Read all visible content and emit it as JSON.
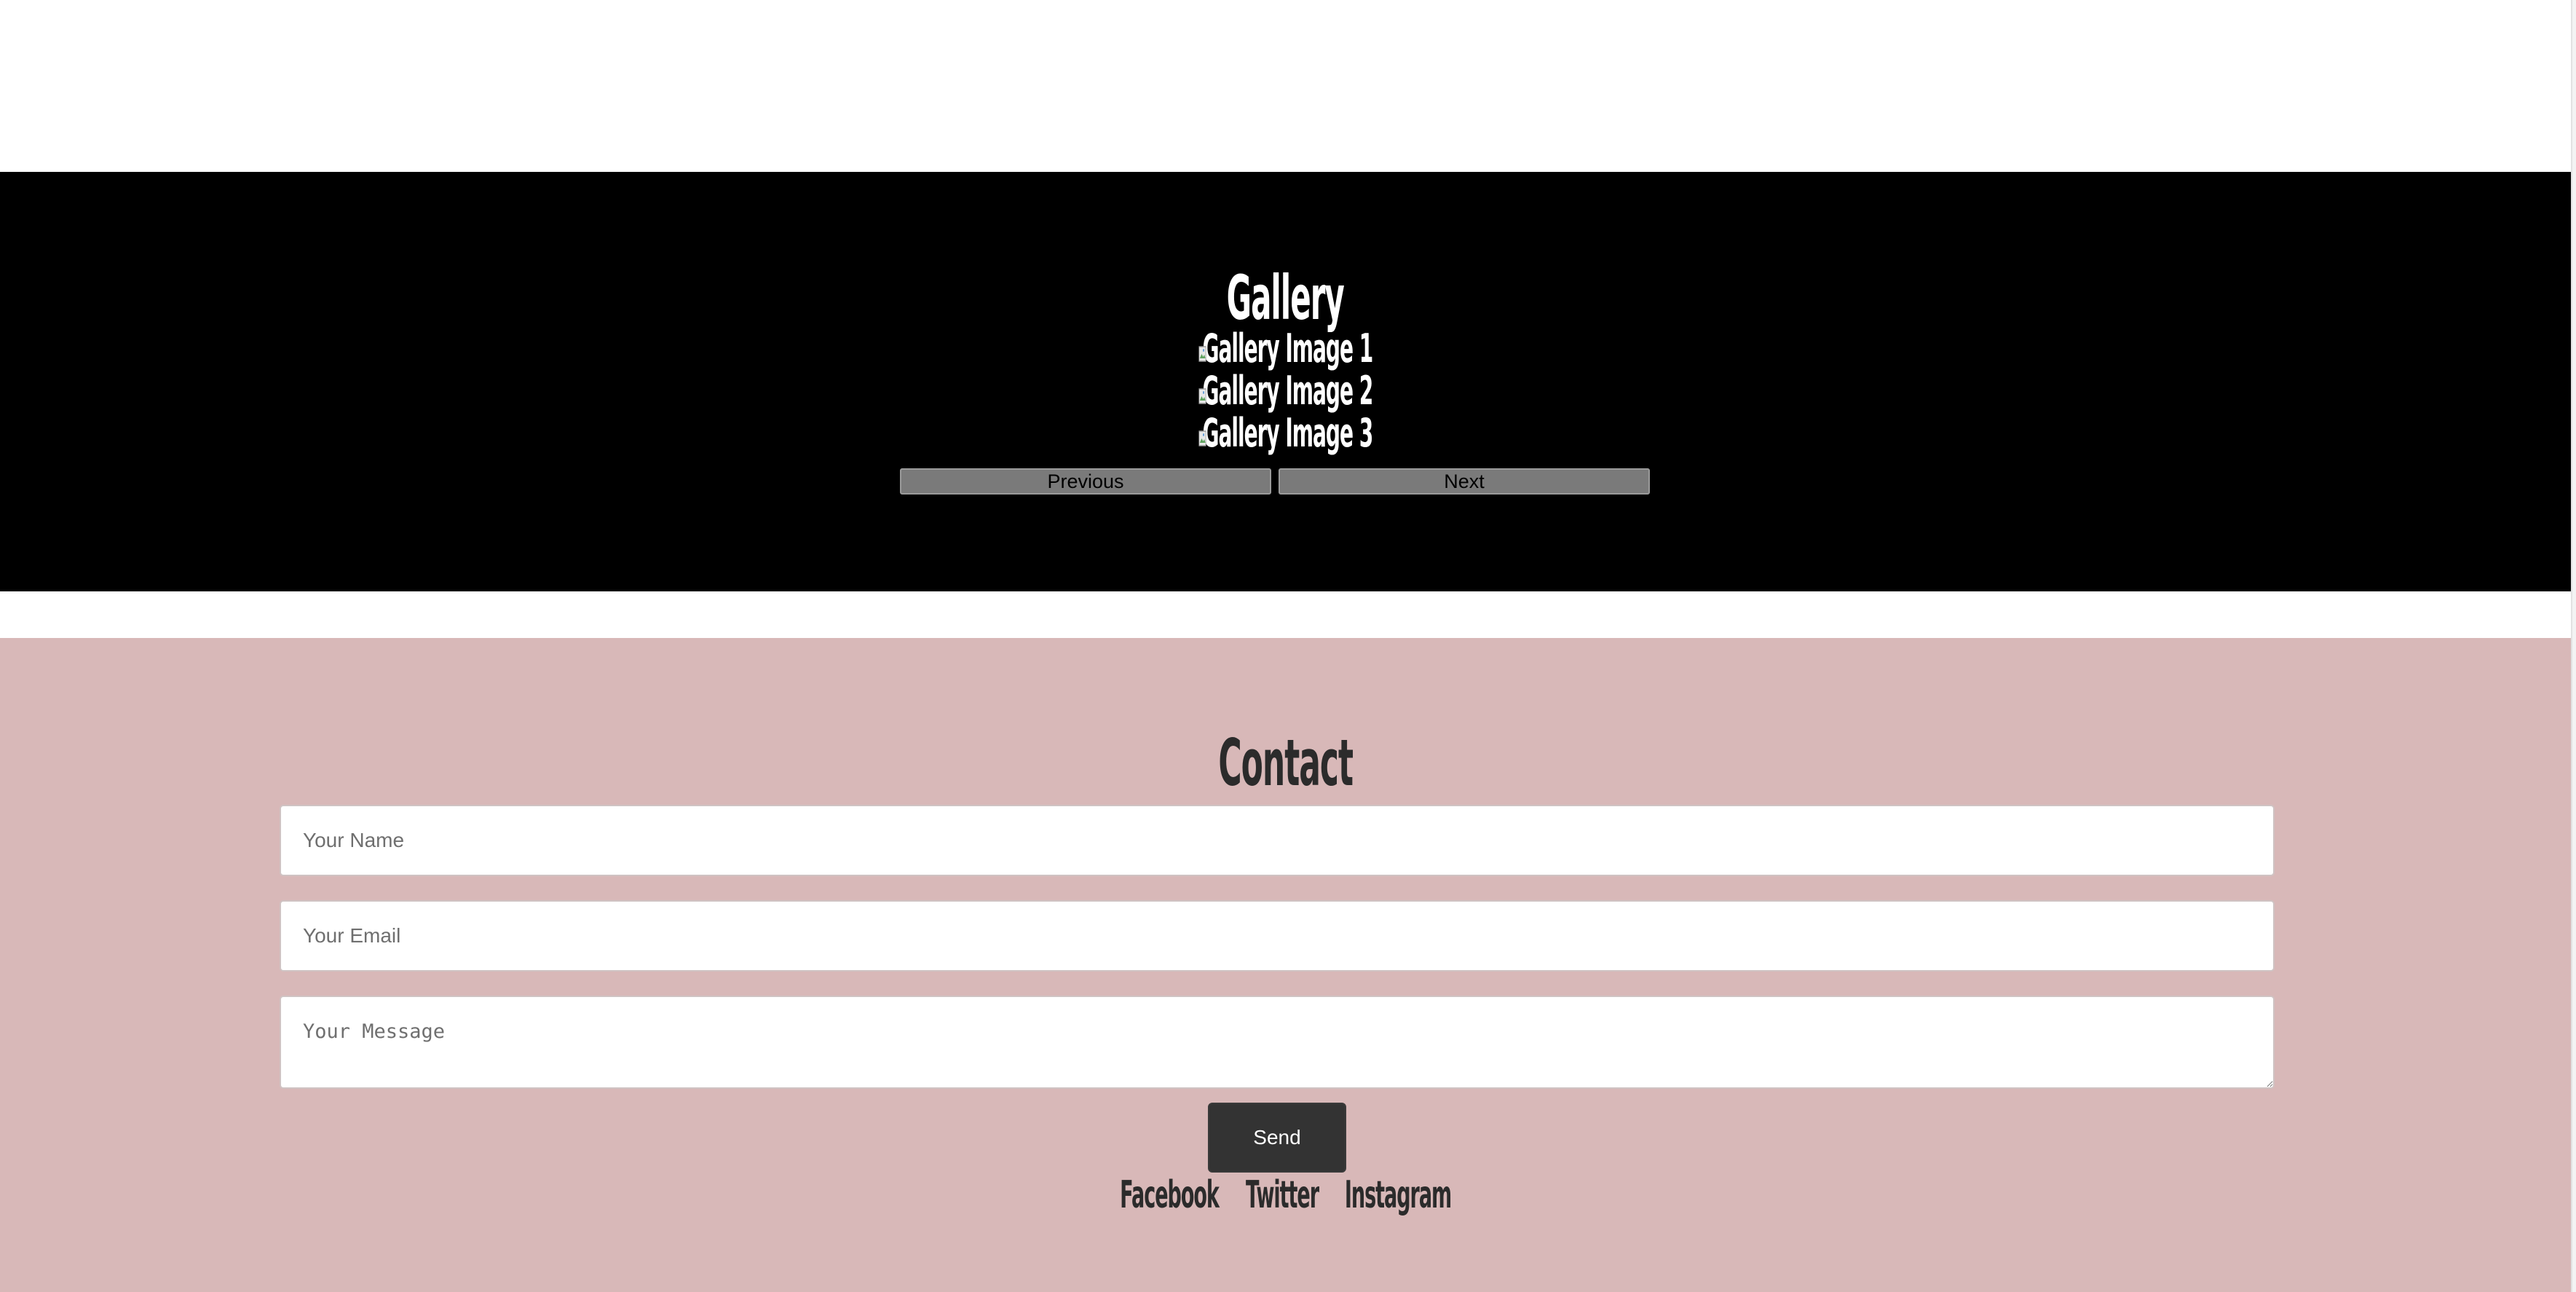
{
  "gallery": {
    "title": "Gallery",
    "images": [
      {
        "alt": "Gallery Image 1"
      },
      {
        "alt": "Gallery Image 2"
      },
      {
        "alt": "Gallery Image 3"
      }
    ],
    "prev_label": "Previous",
    "next_label": "Next"
  },
  "contact": {
    "title": "Contact",
    "name_placeholder": "Your Name",
    "email_placeholder": "Your Email",
    "message_placeholder": "Your Message",
    "send_label": "Send"
  },
  "social": {
    "links": [
      {
        "label": "Facebook"
      },
      {
        "label": "Twitter"
      },
      {
        "label": "Instagram"
      }
    ]
  },
  "colors": {
    "gallery_bg": "#000000",
    "contact_bg": "#d8b8b8",
    "button_dark": "#333333",
    "nav_button": "#7a7a7a"
  }
}
